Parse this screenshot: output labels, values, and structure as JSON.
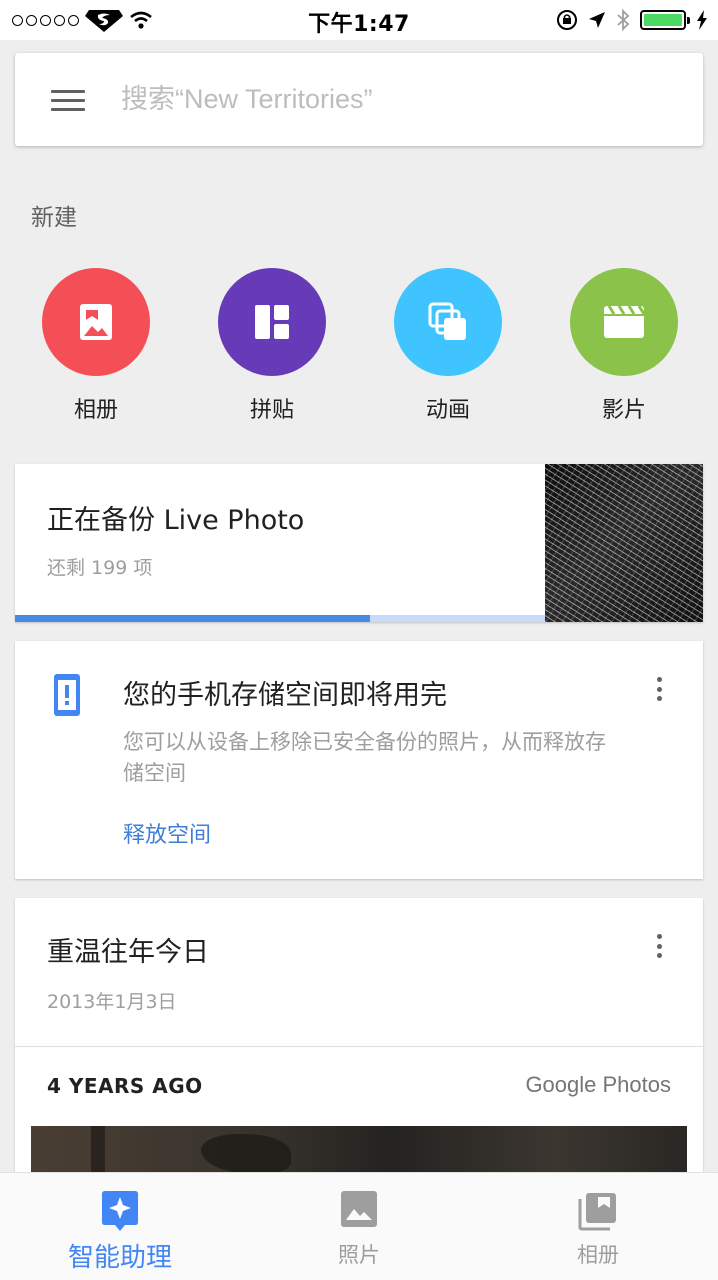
{
  "status_bar": {
    "time": "下午1:47",
    "battery_color": "#4cd964"
  },
  "search": {
    "placeholder": "搜索“New Territories”"
  },
  "create": {
    "title": "新建",
    "items": [
      {
        "label": "相册",
        "color": "#f44f57",
        "icon": "album-icon"
      },
      {
        "label": "拼贴",
        "color": "#673ab7",
        "icon": "collage-icon"
      },
      {
        "label": "动画",
        "color": "#40c4ff",
        "icon": "animation-icon"
      },
      {
        "label": "影片",
        "color": "#8bc34a",
        "icon": "movie-icon"
      }
    ]
  },
  "backup": {
    "title": "正在备份 Live Photo",
    "subtitle": "还剩 199 项",
    "progress": 0.67,
    "progress_color": "#4a88e8"
  },
  "storage": {
    "title": "您的手机存储空间即将用完",
    "body": "您可以从设备上移除已安全备份的照片，从而释放存储空间",
    "action": "释放空间",
    "accent": "#4285f4"
  },
  "memory": {
    "title": "重温往年今日",
    "date": "2013年1月3日",
    "years_ago": "4 YEARS AGO",
    "brand_google": "Google",
    "brand_photos": " Photos"
  },
  "bottom_nav": {
    "items": [
      {
        "label": "智能助理",
        "icon": "assistant-icon",
        "active": true
      },
      {
        "label": "照片",
        "icon": "photos-icon",
        "active": false
      },
      {
        "label": "相册",
        "icon": "albums-icon",
        "active": false
      }
    ],
    "active_color": "#4285f4"
  }
}
